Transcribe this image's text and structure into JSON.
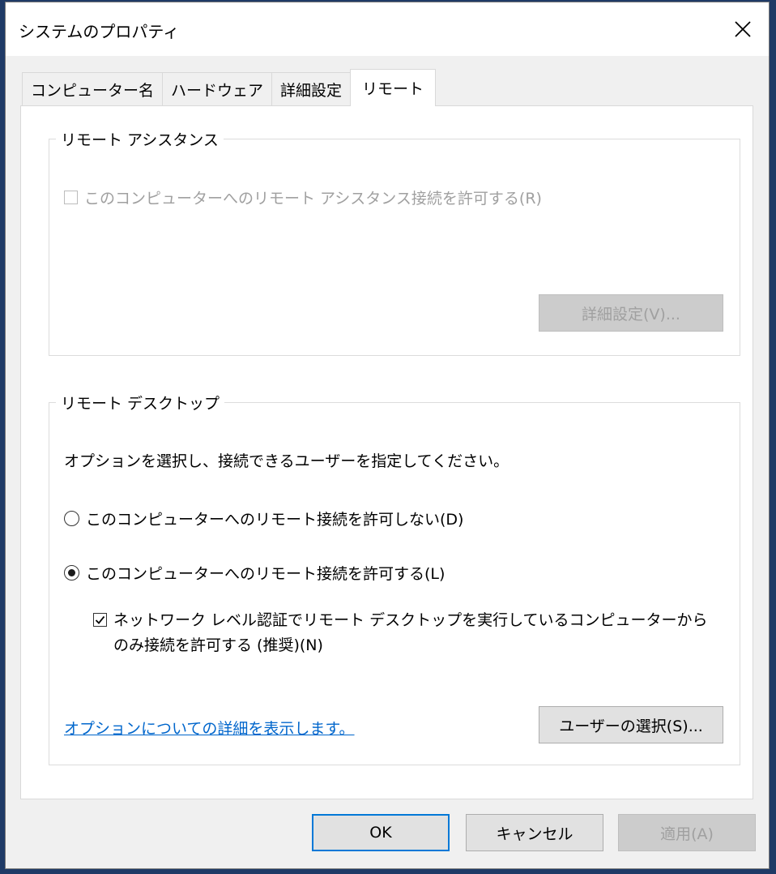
{
  "window": {
    "title": "システムのプロパティ"
  },
  "tabs": [
    {
      "label": "コンピューター名"
    },
    {
      "label": "ハードウェア"
    },
    {
      "label": "詳細設定"
    },
    {
      "label": "リモート"
    }
  ],
  "remote_assistance": {
    "group_title": "リモート アシスタンス",
    "allow_label": "このコンピューターへのリモート アシスタンス接続を許可する(R)",
    "allow_checked": false,
    "advanced_button": "詳細設定(V)..."
  },
  "remote_desktop": {
    "group_title": "リモート デスクトップ",
    "instruction": "オプションを選択し、接続できるユーザーを指定してください。",
    "option_disallow": "このコンピューターへのリモート接続を許可しない(D)",
    "option_allow": "このコンピューターへのリモート接続を許可する(L)",
    "selected_option": "allow",
    "nla_label_line1": "ネットワーク レベル認証でリモート デスクトップを実行しているコンピューターから",
    "nla_label_line2": "のみ接続を許可する (推奨)(N)",
    "nla_checked": true,
    "help_link": "オプションについての詳細を表示します。",
    "select_users_button": "ユーザーの選択(S)..."
  },
  "footer": {
    "ok": "OK",
    "cancel": "キャンセル",
    "apply": "適用(A)"
  }
}
